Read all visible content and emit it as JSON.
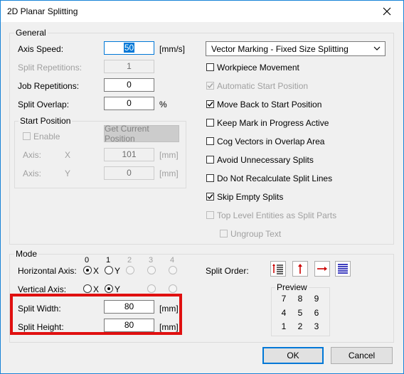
{
  "window": {
    "title": "2D Planar Splitting"
  },
  "general": {
    "group_label": "General",
    "axis_speed_label": "Axis Speed:",
    "axis_speed_value": "50",
    "axis_speed_unit": "[mm/s]",
    "split_repetitions_label": "Split Repetitions:",
    "split_repetitions_value": "1",
    "job_repetitions_label": "Job Repetitions:",
    "job_repetitions_value": "0",
    "split_overlap_label": "Split Overlap:",
    "split_overlap_value": "0",
    "split_overlap_unit": "%",
    "marking_mode": "Vector Marking - Fixed Size Splitting",
    "start_position": {
      "group_label": "Start Position",
      "enable_label": "Enable",
      "get_position_label": "Get Current Position",
      "axis_x_label": "Axis:",
      "axis_x_name": "X",
      "axis_x_value": "101",
      "axis_x_unit": "[mm]",
      "axis_y_label": "Axis:",
      "axis_y_name": "Y",
      "axis_y_value": "0",
      "axis_y_unit": "[mm]"
    },
    "options": [
      {
        "label": "Workpiece Movement",
        "checked": false,
        "enabled": true
      },
      {
        "label": "Automatic Start Position",
        "checked": true,
        "enabled": false
      },
      {
        "label": "Move Back to Start Position",
        "checked": true,
        "enabled": true
      },
      {
        "label": "Keep Mark in Progress Active",
        "checked": false,
        "enabled": true
      },
      {
        "label": "Cog Vectors in Overlap Area",
        "checked": false,
        "enabled": true
      },
      {
        "label": "Avoid Unnecessary Splits",
        "checked": false,
        "enabled": true
      },
      {
        "label": "Do Not Recalculate Split Lines",
        "checked": false,
        "enabled": true
      },
      {
        "label": "Skip Empty Splits",
        "checked": true,
        "enabled": true
      },
      {
        "label": "Top Level Entities as Split Parts",
        "checked": false,
        "enabled": false
      },
      {
        "label": "Ungroup Text",
        "checked": false,
        "enabled": false
      }
    ]
  },
  "mode": {
    "group_label": "Mode",
    "axis_numbers": [
      "0",
      "1",
      "2",
      "3",
      "4"
    ],
    "horizontal_axis_label": "Horizontal Axis:",
    "vertical_axis_label": "Vertical Axis:",
    "radio_x_label": "X",
    "radio_y_label": "Y",
    "horizontal_selected": "X",
    "vertical_selected": "Y",
    "split_width_label": "Split Width:",
    "split_width_value": "80",
    "split_width_unit": "[mm]",
    "split_height_label": "Split Height:",
    "split_height_value": "80",
    "split_height_unit": "[mm]",
    "split_order_label": "Split Order:",
    "preview_label": "Preview",
    "preview_grid": [
      [
        "7",
        "8",
        "9"
      ],
      [
        "4",
        "5",
        "6"
      ],
      [
        "1",
        "2",
        "3"
      ]
    ]
  },
  "buttons": {
    "ok_label": "OK",
    "cancel_label": "Cancel"
  },
  "colors": {
    "accent": "#0078d7",
    "highlight": "#e01010",
    "arrow_red": "#cc0000",
    "icon_blue": "#0000aa"
  }
}
